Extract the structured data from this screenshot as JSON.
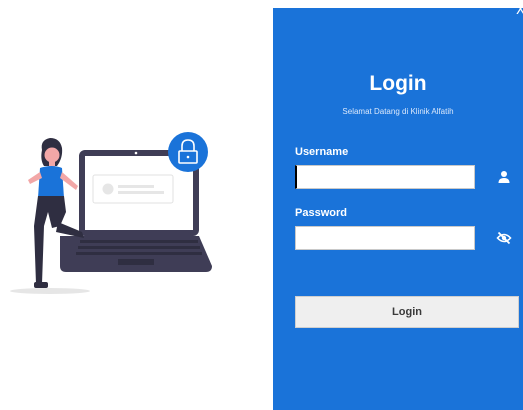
{
  "window": {
    "close_label": "X"
  },
  "login": {
    "title": "Login",
    "subtitle": "Selamat Datang di Klinik Alfatih",
    "username_label": "Username",
    "username_value": "",
    "password_label": "Password",
    "password_value": "",
    "button_label": "Login"
  },
  "colors": {
    "panel": "#1a73d9",
    "accent_circle": "#1a73d9",
    "laptop": "#3f3d56",
    "button_bg": "#efefef"
  },
  "icons": {
    "username": "user-icon",
    "password": "eye-slash-icon",
    "lock": "lock-icon",
    "close": "close-icon"
  }
}
